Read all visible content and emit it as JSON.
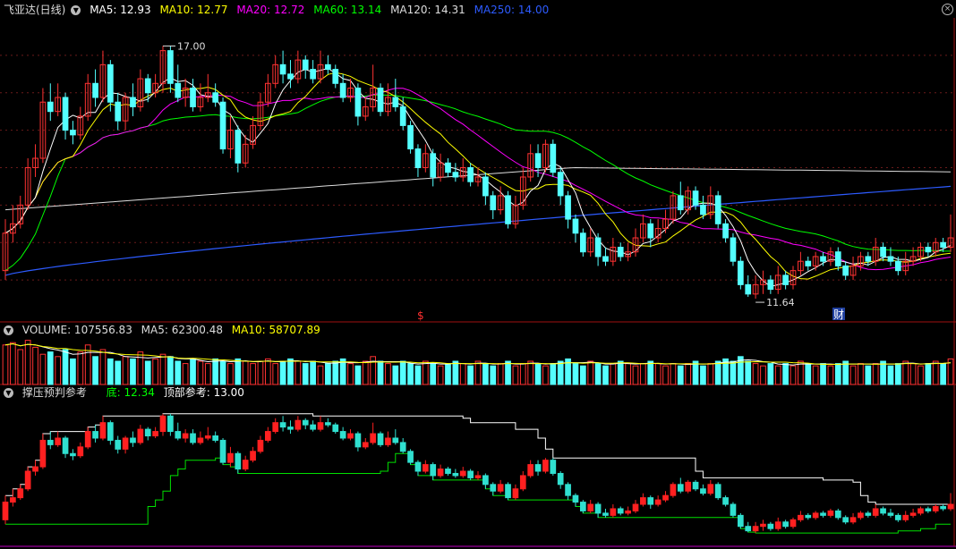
{
  "colors": {
    "up": "#ff3232",
    "down": "#54ffff",
    "ma5": "#ffffff",
    "ma10": "#ffff00",
    "ma20": "#ff00ff",
    "ma60": "#00ff00",
    "ma120": "#dddddd",
    "ma250": "#2d5bff",
    "divider": "#a01010",
    "grid": "#6a1a1a",
    "bottom_line": "#00e000",
    "top_line": "#ffffff"
  },
  "price_panel": {
    "title": "飞亚达(日线)",
    "ma_labels": [
      {
        "text": "MA5: 12.93",
        "color": "#ffffff"
      },
      {
        "text": "MA10: 12.77",
        "color": "#ffff00"
      },
      {
        "text": "MA20: 12.72",
        "color": "#ff00ff"
      },
      {
        "text": "MA60: 13.14",
        "color": "#00ff00"
      },
      {
        "text": "MA120: 14.31",
        "color": "#dddddd"
      },
      {
        "text": "MA250: 14.00",
        "color": "#2d5bff"
      }
    ],
    "high_label": "17.00",
    "low_label": "11.64",
    "marker_s": "$",
    "marker_cai": "财"
  },
  "volume_panel": {
    "labels": [
      {
        "text": "VOLUME: 107556.83",
        "color": "#dddddd"
      },
      {
        "text": "MA5: 62300.48",
        "color": "#dddddd"
      },
      {
        "text": "MA10: 58707.89",
        "color": "#ffff00"
      }
    ]
  },
  "indicator_panel": {
    "labels": [
      {
        "text": "撑压预判参考",
        "color": "#dddddd"
      },
      {
        "text": "底: 12.34",
        "color": "#00ff00"
      },
      {
        "text": "顶部参考: 13.00",
        "color": "#ffffff"
      }
    ]
  },
  "chart_data": {
    "type": "candlestick",
    "yrange": [
      11.2,
      17.6
    ],
    "candles": [
      [
        12.2,
        13.0,
        13.3,
        12.0
      ],
      [
        13.0,
        13.2,
        13.6,
        12.8
      ],
      [
        13.2,
        13.6,
        13.8,
        13.1
      ],
      [
        13.6,
        14.4,
        14.6,
        13.5
      ],
      [
        14.4,
        14.6,
        14.9,
        14.2
      ],
      [
        14.6,
        15.8,
        16.1,
        14.5
      ],
      [
        15.8,
        15.6,
        16.2,
        15.4
      ],
      [
        15.6,
        15.9,
        16.2,
        15.5
      ],
      [
        15.9,
        15.2,
        16.0,
        15.0
      ],
      [
        15.2,
        15.1,
        15.4,
        14.9
      ],
      [
        15.1,
        15.5,
        15.7,
        15.0
      ],
      [
        15.5,
        16.2,
        16.4,
        15.4
      ],
      [
        16.2,
        15.9,
        16.5,
        15.7
      ],
      [
        15.9,
        16.6,
        16.9,
        15.8
      ],
      [
        16.6,
        15.8,
        16.7,
        15.6
      ],
      [
        15.8,
        15.4,
        16.0,
        15.2
      ],
      [
        15.4,
        15.9,
        16.0,
        15.2
      ],
      [
        15.9,
        15.7,
        16.2,
        15.5
      ],
      [
        15.7,
        16.3,
        16.5,
        15.6
      ],
      [
        16.3,
        16.0,
        16.4,
        15.8
      ],
      [
        16.0,
        16.2,
        16.4,
        15.9
      ],
      [
        16.2,
        16.9,
        17.0,
        16.0
      ],
      [
        16.9,
        16.2,
        17.0,
        16.0
      ],
      [
        16.2,
        15.9,
        16.6,
        15.8
      ],
      [
        15.9,
        16.1,
        16.3,
        15.7
      ],
      [
        16.1,
        15.7,
        16.3,
        15.6
      ],
      [
        15.7,
        15.9,
        16.2,
        15.6
      ],
      [
        15.9,
        16.0,
        16.4,
        15.8
      ],
      [
        16.0,
        15.8,
        16.2,
        15.7
      ],
      [
        15.8,
        14.8,
        15.9,
        14.7
      ],
      [
        14.8,
        15.2,
        15.5,
        14.6
      ],
      [
        15.2,
        14.5,
        15.3,
        14.3
      ],
      [
        14.5,
        14.9,
        15.1,
        14.4
      ],
      [
        14.9,
        15.3,
        15.5,
        14.8
      ],
      [
        15.3,
        15.8,
        16.0,
        15.2
      ],
      [
        15.8,
        16.2,
        16.4,
        15.7
      ],
      [
        16.2,
        16.6,
        16.8,
        16.1
      ],
      [
        16.6,
        16.4,
        16.9,
        16.2
      ],
      [
        16.4,
        16.3,
        16.7,
        16.1
      ],
      [
        16.3,
        16.7,
        16.9,
        16.2
      ],
      [
        16.7,
        16.5,
        16.8,
        16.3
      ],
      [
        16.5,
        16.3,
        16.7,
        16.2
      ],
      [
        16.3,
        16.6,
        16.9,
        16.2
      ],
      [
        16.6,
        16.5,
        16.8,
        16.4
      ],
      [
        16.5,
        16.2,
        16.6,
        16.1
      ],
      [
        16.2,
        15.9,
        16.4,
        15.8
      ],
      [
        15.9,
        16.1,
        16.3,
        15.8
      ],
      [
        16.1,
        15.5,
        16.2,
        15.3
      ],
      [
        15.5,
        15.7,
        15.9,
        15.4
      ],
      [
        15.7,
        16.1,
        16.6,
        15.6
      ],
      [
        16.1,
        15.6,
        16.2,
        15.5
      ],
      [
        15.6,
        15.9,
        16.2,
        15.5
      ],
      [
        15.9,
        15.7,
        16.3,
        15.6
      ],
      [
        15.7,
        15.3,
        15.9,
        15.2
      ],
      [
        15.3,
        14.8,
        15.4,
        14.7
      ],
      [
        14.8,
        14.4,
        14.9,
        14.2
      ],
      [
        14.4,
        14.7,
        14.9,
        14.3
      ],
      [
        14.7,
        14.2,
        14.8,
        14.0
      ],
      [
        14.2,
        14.5,
        14.7,
        14.1
      ],
      [
        14.5,
        14.3,
        14.6,
        14.2
      ],
      [
        14.3,
        14.2,
        14.5,
        14.1
      ],
      [
        14.2,
        14.4,
        14.6,
        14.1
      ],
      [
        14.4,
        14.1,
        14.5,
        14.0
      ],
      [
        14.1,
        14.2,
        14.4,
        14.0
      ],
      [
        14.2,
        13.8,
        14.3,
        13.6
      ],
      [
        13.8,
        13.5,
        13.9,
        13.3
      ],
      [
        13.5,
        13.8,
        14.0,
        13.4
      ],
      [
        13.8,
        13.2,
        13.9,
        13.1
      ],
      [
        13.2,
        13.6,
        13.8,
        13.1
      ],
      [
        13.6,
        14.2,
        14.4,
        13.5
      ],
      [
        14.2,
        14.7,
        14.9,
        14.1
      ],
      [
        14.7,
        14.4,
        14.9,
        14.2
      ],
      [
        14.4,
        14.9,
        15.0,
        14.3
      ],
      [
        14.9,
        14.3,
        15.0,
        14.2
      ],
      [
        14.3,
        13.8,
        14.4,
        13.6
      ],
      [
        13.8,
        13.3,
        13.9,
        13.1
      ],
      [
        13.3,
        13.0,
        13.4,
        12.8
      ],
      [
        13.0,
        12.6,
        13.1,
        12.5
      ],
      [
        12.6,
        12.9,
        13.1,
        12.5
      ],
      [
        12.9,
        12.5,
        13.0,
        12.3
      ],
      [
        12.5,
        12.4,
        12.7,
        12.3
      ],
      [
        12.4,
        12.7,
        12.9,
        12.3
      ],
      [
        12.7,
        12.5,
        12.8,
        12.4
      ],
      [
        12.5,
        12.6,
        12.8,
        12.4
      ],
      [
        12.6,
        12.9,
        13.1,
        12.5
      ],
      [
        12.9,
        13.2,
        13.4,
        12.8
      ],
      [
        13.2,
        12.9,
        13.3,
        12.7
      ],
      [
        12.9,
        13.1,
        13.3,
        12.8
      ],
      [
        13.1,
        13.3,
        13.5,
        13.0
      ],
      [
        13.3,
        13.8,
        13.9,
        13.2
      ],
      [
        13.8,
        13.5,
        14.1,
        13.4
      ],
      [
        13.5,
        13.9,
        14.0,
        13.4
      ],
      [
        13.9,
        13.6,
        14.0,
        13.5
      ],
      [
        13.6,
        13.4,
        13.8,
        13.3
      ],
      [
        13.4,
        13.8,
        14.0,
        13.3
      ],
      [
        13.8,
        13.2,
        13.9,
        13.1
      ],
      [
        13.2,
        12.9,
        13.3,
        12.8
      ],
      [
        12.9,
        12.4,
        13.0,
        12.3
      ],
      [
        12.4,
        11.9,
        12.5,
        11.8
      ],
      [
        11.9,
        11.7,
        12.1,
        11.64
      ],
      [
        11.7,
        11.9,
        12.1,
        11.6
      ],
      [
        11.9,
        12.0,
        12.2,
        11.7
      ],
      [
        12.0,
        11.8,
        12.1,
        11.7
      ],
      [
        11.8,
        12.1,
        12.3,
        11.7
      ],
      [
        12.1,
        11.9,
        12.2,
        11.8
      ],
      [
        11.9,
        12.2,
        12.3,
        11.8
      ],
      [
        12.2,
        12.4,
        12.6,
        12.1
      ],
      [
        12.4,
        12.3,
        12.5,
        12.2
      ],
      [
        12.3,
        12.5,
        12.6,
        12.2
      ],
      [
        12.5,
        12.4,
        12.6,
        12.3
      ],
      [
        12.4,
        12.6,
        12.7,
        12.3
      ],
      [
        12.6,
        12.3,
        12.7,
        12.2
      ],
      [
        12.3,
        12.1,
        12.4,
        12.0
      ],
      [
        12.1,
        12.3,
        12.5,
        12.0
      ],
      [
        12.3,
        12.5,
        12.6,
        12.2
      ],
      [
        12.5,
        12.4,
        12.6,
        12.3
      ],
      [
        12.4,
        12.7,
        12.9,
        12.3
      ],
      [
        12.7,
        12.5,
        12.8,
        12.4
      ],
      [
        12.5,
        12.4,
        12.7,
        12.3
      ],
      [
        12.4,
        12.2,
        12.5,
        12.1
      ],
      [
        12.2,
        12.4,
        12.6,
        12.1
      ],
      [
        12.4,
        12.5,
        12.7,
        12.3
      ],
      [
        12.5,
        12.7,
        12.8,
        12.4
      ],
      [
        12.7,
        12.6,
        12.8,
        12.5
      ],
      [
        12.6,
        12.8,
        12.9,
        12.5
      ],
      [
        12.8,
        12.7,
        12.9,
        12.6
      ],
      [
        12.7,
        12.9,
        13.4,
        12.6
      ]
    ],
    "volumes": [
      0.85,
      0.9,
      0.75,
      0.95,
      0.8,
      0.65,
      0.7,
      0.6,
      0.75,
      0.55,
      0.7,
      0.85,
      0.6,
      0.75,
      0.55,
      0.5,
      0.6,
      0.55,
      0.7,
      0.5,
      0.55,
      0.65,
      0.6,
      0.5,
      0.45,
      0.55,
      0.5,
      0.45,
      0.55,
      0.5,
      0.45,
      0.55,
      0.5,
      0.45,
      0.5,
      0.55,
      0.45,
      0.5,
      0.55,
      0.5,
      0.45,
      0.5,
      0.4,
      0.45,
      0.5,
      0.55,
      0.45,
      0.4,
      0.5,
      0.6,
      0.5,
      0.45,
      0.4,
      0.5,
      0.45,
      0.4,
      0.5,
      0.45,
      0.4,
      0.45,
      0.5,
      0.45,
      0.4,
      0.5,
      0.45,
      0.4,
      0.45,
      0.5,
      0.4,
      0.45,
      0.5,
      0.45,
      0.4,
      0.45,
      0.5,
      0.55,
      0.45,
      0.4,
      0.5,
      0.45,
      0.4,
      0.45,
      0.5,
      0.45,
      0.4,
      0.45,
      0.5,
      0.45,
      0.4,
      0.45,
      0.4,
      0.45,
      0.5,
      0.4,
      0.45,
      0.5,
      0.55,
      0.5,
      0.6,
      0.5,
      0.45,
      0.4,
      0.45,
      0.4,
      0.45,
      0.4,
      0.5,
      0.45,
      0.4,
      0.45,
      0.4,
      0.45,
      0.5,
      0.4,
      0.45,
      0.4,
      0.45,
      0.5,
      0.4,
      0.45,
      0.5,
      0.45,
      0.4,
      0.45,
      0.5,
      0.45,
      0.55
    ],
    "ma_values": {
      "ma5": 12.93,
      "ma10": 12.77,
      "ma20": 12.72,
      "ma60": 13.14,
      "ma120": 14.31,
      "ma250": 14.0
    },
    "ma_endpoints": {
      "ma120": {
        "start": 13.5,
        "mid": 14.4,
        "end": 14.31
      },
      "ma250": {
        "start": 12.1,
        "end": 14.0
      },
      "ma60": {
        "start": 12.2,
        "peak": 15.5,
        "end": 13.14
      }
    },
    "high": 17.0,
    "low": 11.64,
    "bottom_ref": 12.34,
    "top_ref": 13.0,
    "volume_readout": {
      "volume": 107556.83,
      "ma5": 62300.48,
      "ma10": 58707.89
    }
  }
}
